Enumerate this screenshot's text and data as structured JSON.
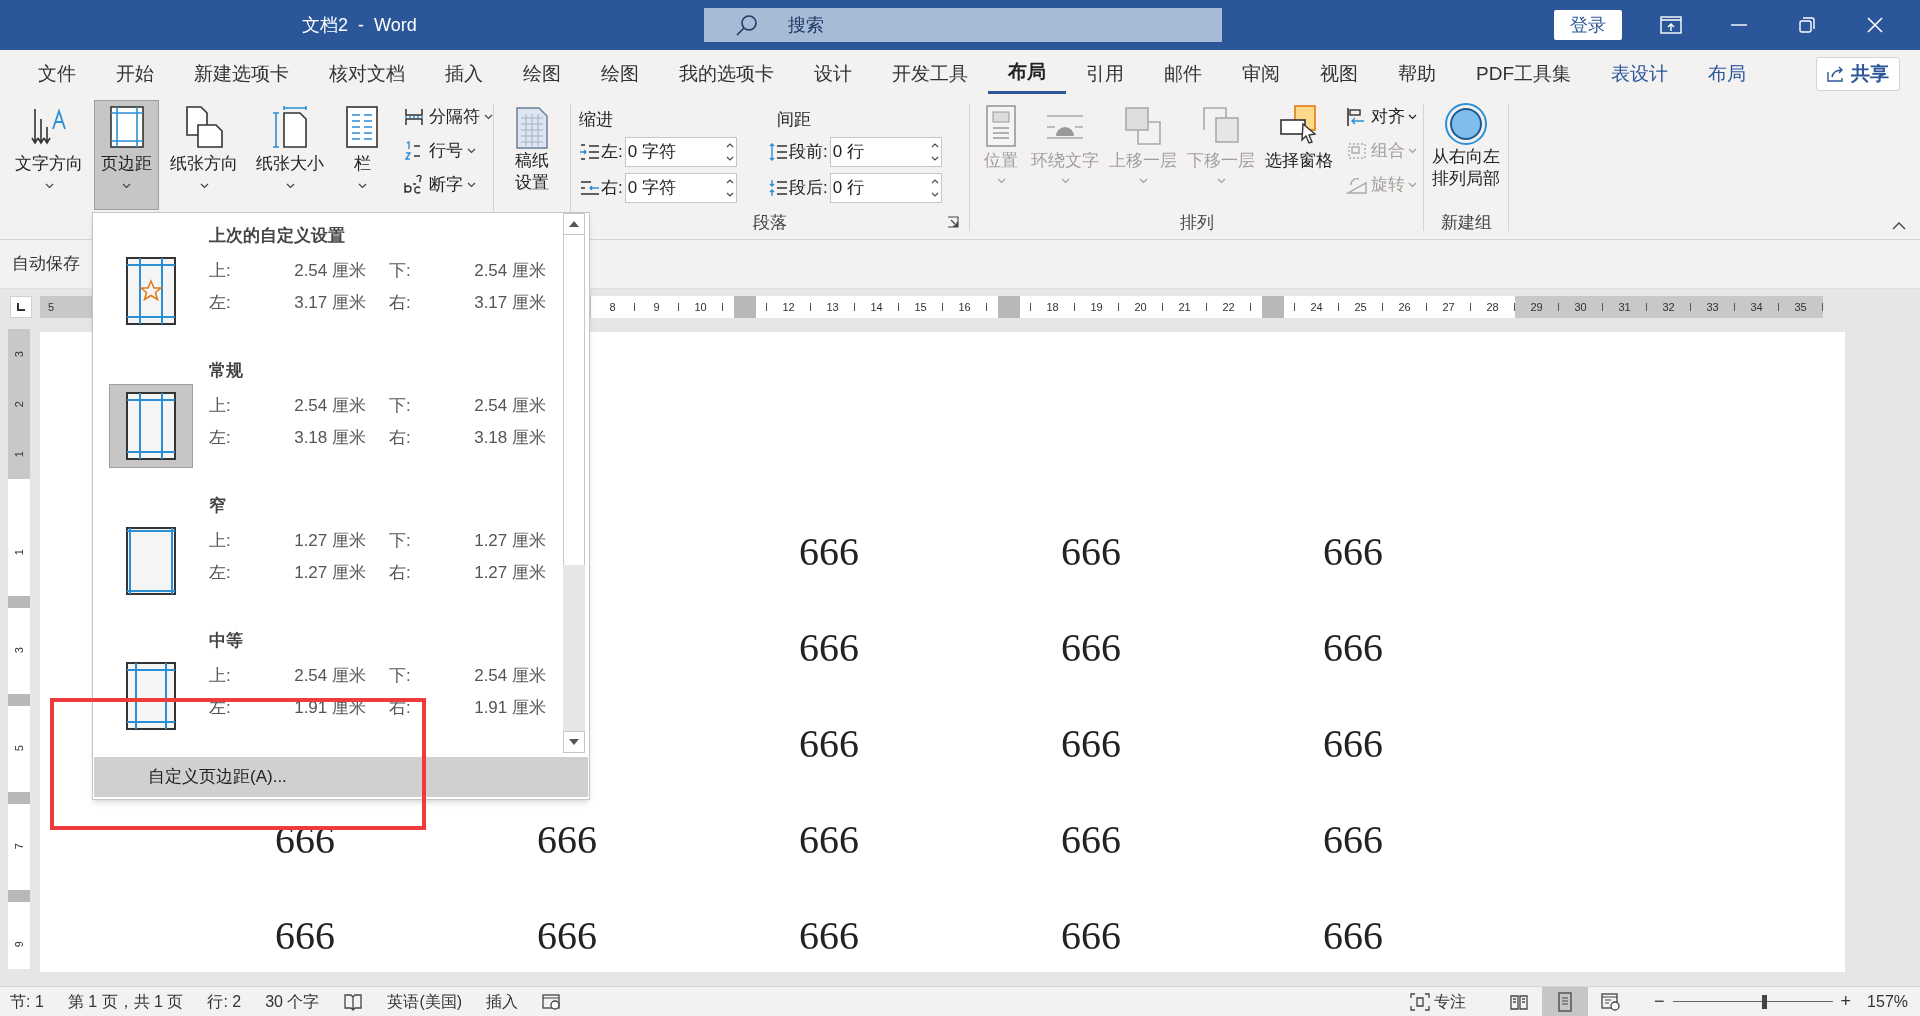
{
  "window": {
    "title": "文档2  -  Word",
    "search_placeholder": "搜索",
    "sign_in": "登录"
  },
  "tabs": [
    {
      "label": "文件",
      "selected": false,
      "kind": "normal"
    },
    {
      "label": "开始",
      "selected": false,
      "kind": "normal"
    },
    {
      "label": "新建选项卡",
      "selected": false,
      "kind": "normal"
    },
    {
      "label": "核对文档",
      "selected": false,
      "kind": "normal"
    },
    {
      "label": "插入",
      "selected": false,
      "kind": "normal"
    },
    {
      "label": "绘图",
      "selected": false,
      "kind": "normal"
    },
    {
      "label": "绘图",
      "selected": false,
      "kind": "normal"
    },
    {
      "label": "我的选项卡",
      "selected": false,
      "kind": "normal"
    },
    {
      "label": "设计",
      "selected": false,
      "kind": "normal"
    },
    {
      "label": "开发工具",
      "selected": false,
      "kind": "normal"
    },
    {
      "label": "布局",
      "selected": true,
      "kind": "normal"
    },
    {
      "label": "引用",
      "selected": false,
      "kind": "normal"
    },
    {
      "label": "邮件",
      "selected": false,
      "kind": "normal"
    },
    {
      "label": "审阅",
      "selected": false,
      "kind": "normal"
    },
    {
      "label": "视图",
      "selected": false,
      "kind": "normal"
    },
    {
      "label": "帮助",
      "selected": false,
      "kind": "normal"
    },
    {
      "label": "PDF工具集",
      "selected": false,
      "kind": "normal"
    },
    {
      "label": "表设计",
      "selected": false,
      "kind": "context"
    },
    {
      "label": "布局",
      "selected": false,
      "kind": "context"
    }
  ],
  "share": "共享",
  "ribbon": {
    "page_setup": [
      {
        "label": "文字方向",
        "kind": "text-direction",
        "selected": false
      },
      {
        "label": "页边距",
        "kind": "margins",
        "selected": true
      },
      {
        "label": "纸张方向",
        "kind": "orientation",
        "selected": false
      },
      {
        "label": "纸张大小",
        "kind": "size",
        "selected": false
      },
      {
        "label": "栏",
        "kind": "columns",
        "selected": false
      }
    ],
    "page_setup_small": [
      {
        "label": "分隔符",
        "kind": "breaks"
      },
      {
        "label": "行号",
        "kind": "line-numbers"
      },
      {
        "label": "断字",
        "kind": "hyphenation"
      }
    ],
    "manuscript": [
      "稿纸",
      "设置"
    ],
    "paragraph": {
      "title": "段落",
      "indent_label": "缩进",
      "spacing_label": "间距",
      "indent": [
        {
          "label": "左:",
          "value": "0 字符",
          "kind": "indent-left"
        },
        {
          "label": "右:",
          "value": "0 字符",
          "kind": "indent-right"
        }
      ],
      "spacing": [
        {
          "label": "段前:",
          "value": "0 行",
          "kind": "before"
        },
        {
          "label": "段后:",
          "value": "0 行",
          "kind": "after"
        }
      ]
    },
    "arrange": {
      "title": "排列",
      "buttons": [
        {
          "label": "位置",
          "kind": "position",
          "disabled": true
        },
        {
          "label": "环绕文字",
          "kind": "wrap",
          "disabled": true
        },
        {
          "label": "上移一层",
          "kind": "forward",
          "disabled": true
        },
        {
          "label": "下移一层",
          "kind": "backward",
          "disabled": true
        },
        {
          "label": "选择窗格",
          "kind": "pane",
          "disabled": false
        }
      ],
      "small": [
        {
          "label": "对齐",
          "kind": "align",
          "disabled": false
        },
        {
          "label": "组合",
          "kind": "group",
          "disabled": true
        },
        {
          "label": "旋转",
          "kind": "rotate",
          "disabled": true
        }
      ]
    },
    "new_group": {
      "title": "新建组",
      "button": [
        "从右向左",
        "排列局部"
      ]
    }
  },
  "quick_access": "自动保存",
  "ruler": {
    "left": [
      {
        "label": "5"
      }
    ],
    "marks": [
      {
        "kind": "number",
        "label": "8",
        "margin": false
      },
      {
        "kind": "number",
        "label": "9",
        "margin": false
      },
      {
        "kind": "number",
        "label": "10",
        "margin": false
      },
      {
        "kind": "marker",
        "margin": false
      },
      {
        "kind": "number",
        "label": "12",
        "margin": false
      },
      {
        "kind": "number",
        "label": "13",
        "margin": false
      },
      {
        "kind": "number",
        "label": "14",
        "margin": false
      },
      {
        "kind": "number",
        "label": "15",
        "margin": false
      },
      {
        "kind": "number",
        "label": "16",
        "margin": false
      },
      {
        "kind": "marker",
        "margin": false
      },
      {
        "kind": "number",
        "label": "18",
        "margin": false
      },
      {
        "kind": "number",
        "label": "19",
        "margin": false
      },
      {
        "kind": "number",
        "label": "20",
        "margin": false
      },
      {
        "kind": "number",
        "label": "21",
        "margin": false
      },
      {
        "kind": "number",
        "label": "22",
        "margin": false
      },
      {
        "kind": "marker",
        "margin": false
      },
      {
        "kind": "number",
        "label": "24",
        "margin": false
      },
      {
        "kind": "number",
        "label": "25",
        "margin": false
      },
      {
        "kind": "number",
        "label": "26",
        "margin": false
      },
      {
        "kind": "number",
        "label": "27",
        "margin": false
      },
      {
        "kind": "number",
        "label": "28",
        "margin": false
      },
      {
        "kind": "number",
        "label": "29",
        "margin": true
      },
      {
        "kind": "number",
        "label": "30",
        "margin": true
      },
      {
        "kind": "number",
        "label": "31",
        "margin": true
      },
      {
        "kind": "number",
        "label": "32",
        "margin": true
      },
      {
        "kind": "number",
        "label": "33",
        "margin": true
      },
      {
        "kind": "number",
        "label": "34",
        "margin": true
      },
      {
        "kind": "number",
        "label": "35",
        "margin": true
      }
    ]
  },
  "vertical_ruler": [
    {
      "kind": "number",
      "label": "3",
      "margin": true
    },
    {
      "kind": "number",
      "label": "2",
      "margin": true
    },
    {
      "kind": "number",
      "label": "1",
      "margin": true
    },
    {
      "kind": "blank",
      "margin": false
    },
    {
      "kind": "number",
      "label": "1",
      "margin": false
    },
    {
      "kind": "marker",
      "margin": false
    },
    {
      "kind": "number",
      "label": "3",
      "margin": false
    },
    {
      "kind": "marker",
      "margin": false
    },
    {
      "kind": "number",
      "label": "5",
      "margin": false
    },
    {
      "kind": "marker",
      "margin": false
    },
    {
      "kind": "number",
      "label": "7",
      "margin": false
    },
    {
      "kind": "marker",
      "margin": false
    },
    {
      "kind": "number",
      "label": "9",
      "margin": false
    }
  ],
  "document": {
    "rows": [
      {
        "cells": [
          "666",
          "666",
          "666"
        ]
      },
      {
        "cells": [
          "666",
          "666",
          "666"
        ]
      },
      {
        "cells": [
          "666",
          "666",
          "666"
        ]
      },
      {
        "cells": [
          "666",
          "666",
          "666",
          "666",
          "666"
        ]
      },
      {
        "cells": [
          "666",
          "666",
          "666",
          "666",
          "666"
        ]
      }
    ]
  },
  "margins_menu": {
    "items": [
      {
        "kind": "custom",
        "title": "上次的自定义设置",
        "selected": false,
        "values": [
          [
            "上:",
            "2.54 厘米",
            "下:",
            "2.54 厘米"
          ],
          [
            "左:",
            "3.17 厘米",
            "右:",
            "3.17 厘米"
          ]
        ]
      },
      {
        "kind": "normal",
        "title": "常规",
        "selected": true,
        "values": [
          [
            "上:",
            "2.54 厘米",
            "下:",
            "2.54 厘米"
          ],
          [
            "左:",
            "3.18 厘米",
            "右:",
            "3.18 厘米"
          ]
        ]
      },
      {
        "kind": "narrow",
        "title": "窄",
        "selected": false,
        "values": [
          [
            "上:",
            "1.27 厘米",
            "下:",
            "1.27 厘米"
          ],
          [
            "左:",
            "1.27 厘米",
            "右:",
            "1.27 厘米"
          ]
        ]
      },
      {
        "kind": "moderate",
        "title": "中等",
        "selected": false,
        "values": [
          [
            "上:",
            "2.54 厘米",
            "下:",
            "2.54 厘米"
          ],
          [
            "左:",
            "1.91 厘米",
            "右:",
            "1.91 厘米"
          ]
        ]
      }
    ],
    "custom_button": "自定义页边距(A)..."
  },
  "status_bar": {
    "left": [
      {
        "kind": "text",
        "label": "节: 1"
      },
      {
        "kind": "text",
        "label": "第 1 页，共 1 页"
      },
      {
        "kind": "text",
        "label": "行: 2"
      },
      {
        "kind": "text",
        "label": "30 个字"
      },
      {
        "kind": "proofing"
      },
      {
        "kind": "text",
        "label": "英语(美国)"
      },
      {
        "kind": "text",
        "label": "插入"
      },
      {
        "kind": "macro"
      }
    ],
    "focus": "专注",
    "views": [
      {
        "kind": "read",
        "selected": false
      },
      {
        "kind": "print",
        "selected": true
      },
      {
        "kind": "web",
        "selected": false
      }
    ],
    "zoom": {
      "level": 0.57,
      "reading": "157%",
      "minus": "−",
      "plus": "+"
    }
  }
}
